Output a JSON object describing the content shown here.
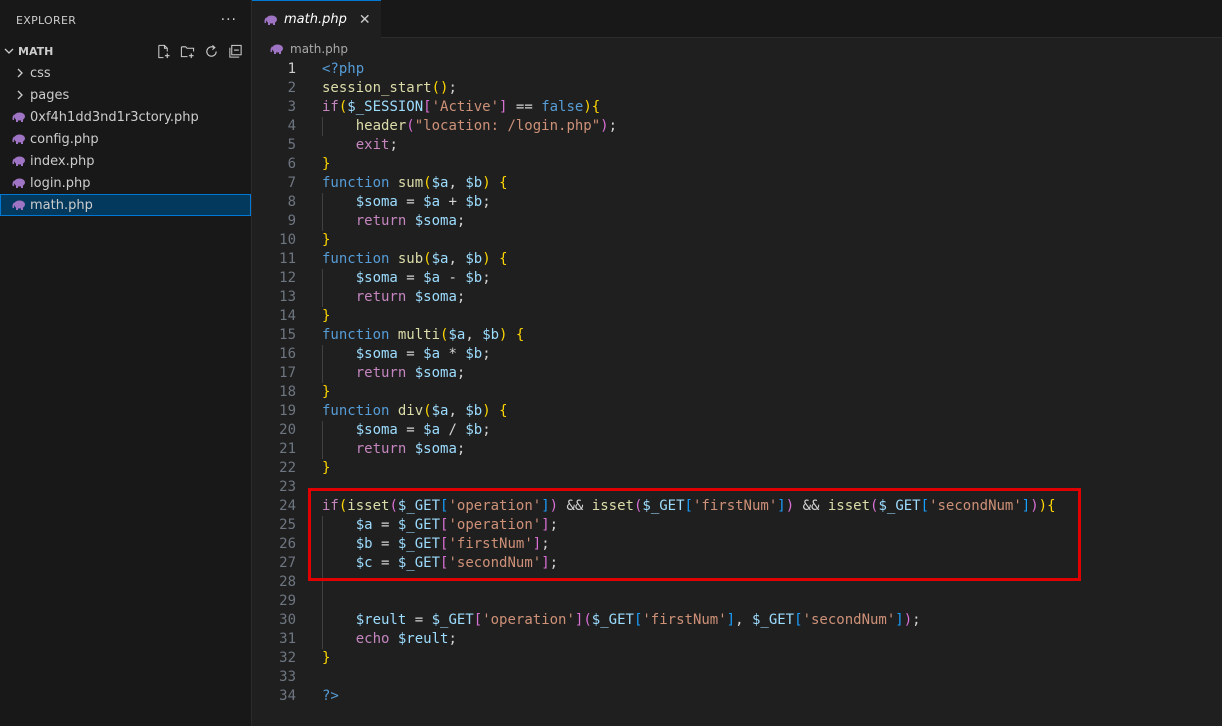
{
  "explorer": {
    "title": "EXPLORER",
    "more": "···",
    "folder": "MATH",
    "items": [
      {
        "type": "dir",
        "label": "css"
      },
      {
        "type": "dir",
        "label": "pages"
      },
      {
        "type": "file",
        "label": "0xf4h1dd3nd1r3ctory.php"
      },
      {
        "type": "file",
        "label": "config.php"
      },
      {
        "type": "file",
        "label": "index.php"
      },
      {
        "type": "file",
        "label": "login.php"
      },
      {
        "type": "file",
        "label": "math.php",
        "selected": true
      }
    ]
  },
  "editor": {
    "tab_label": "math.php",
    "breadcrumb": "math.php",
    "active_line": 1,
    "highlight_color": "#e00000",
    "lines": [
      [
        [
          "b",
          "<?php"
        ]
      ],
      [
        [
          "f",
          "session_start"
        ],
        [
          "p1",
          "()"
        ],
        [
          "t",
          ";"
        ]
      ],
      [
        [
          "k",
          "if"
        ],
        [
          "p1",
          "("
        ],
        [
          "v",
          "$_SESSION"
        ],
        [
          "p2",
          "["
        ],
        [
          "s",
          "'Active'"
        ],
        [
          "p2",
          "]"
        ],
        [
          "t",
          " == "
        ],
        [
          "b",
          "false"
        ],
        [
          "p1",
          ")"
        ],
        [
          "p1",
          "{"
        ]
      ],
      [
        [
          "t",
          "    "
        ],
        [
          "f",
          "header"
        ],
        [
          "p2",
          "("
        ],
        [
          "s",
          "\"location: /login.php\""
        ],
        [
          "p2",
          ")"
        ],
        [
          "t",
          ";"
        ]
      ],
      [
        [
          "t",
          "    "
        ],
        [
          "k",
          "exit"
        ],
        [
          "t",
          ";"
        ]
      ],
      [
        [
          "p1",
          "}"
        ]
      ],
      [
        [
          "b",
          "function"
        ],
        [
          "t",
          " "
        ],
        [
          "f",
          "sum"
        ],
        [
          "p1",
          "("
        ],
        [
          "v",
          "$a"
        ],
        [
          "t",
          ", "
        ],
        [
          "v",
          "$b"
        ],
        [
          "p1",
          ")"
        ],
        [
          "t",
          " "
        ],
        [
          "p1",
          "{"
        ]
      ],
      [
        [
          "t",
          "    "
        ],
        [
          "v",
          "$soma"
        ],
        [
          "t",
          " = "
        ],
        [
          "v",
          "$a"
        ],
        [
          "t",
          " + "
        ],
        [
          "v",
          "$b"
        ],
        [
          "t",
          ";"
        ]
      ],
      [
        [
          "t",
          "    "
        ],
        [
          "k",
          "return"
        ],
        [
          "t",
          " "
        ],
        [
          "v",
          "$soma"
        ],
        [
          "t",
          ";"
        ]
      ],
      [
        [
          "p1",
          "}"
        ]
      ],
      [
        [
          "b",
          "function"
        ],
        [
          "t",
          " "
        ],
        [
          "f",
          "sub"
        ],
        [
          "p1",
          "("
        ],
        [
          "v",
          "$a"
        ],
        [
          "t",
          ", "
        ],
        [
          "v",
          "$b"
        ],
        [
          "p1",
          ")"
        ],
        [
          "t",
          " "
        ],
        [
          "p1",
          "{"
        ]
      ],
      [
        [
          "t",
          "    "
        ],
        [
          "v",
          "$soma"
        ],
        [
          "t",
          " = "
        ],
        [
          "v",
          "$a"
        ],
        [
          "t",
          " - "
        ],
        [
          "v",
          "$b"
        ],
        [
          "t",
          ";"
        ]
      ],
      [
        [
          "t",
          "    "
        ],
        [
          "k",
          "return"
        ],
        [
          "t",
          " "
        ],
        [
          "v",
          "$soma"
        ],
        [
          "t",
          ";"
        ]
      ],
      [
        [
          "p1",
          "}"
        ]
      ],
      [
        [
          "b",
          "function"
        ],
        [
          "t",
          " "
        ],
        [
          "f",
          "multi"
        ],
        [
          "p1",
          "("
        ],
        [
          "v",
          "$a"
        ],
        [
          "t",
          ", "
        ],
        [
          "v",
          "$b"
        ],
        [
          "p1",
          ")"
        ],
        [
          "t",
          " "
        ],
        [
          "p1",
          "{"
        ]
      ],
      [
        [
          "t",
          "    "
        ],
        [
          "v",
          "$soma"
        ],
        [
          "t",
          " = "
        ],
        [
          "v",
          "$a"
        ],
        [
          "t",
          " * "
        ],
        [
          "v",
          "$b"
        ],
        [
          "t",
          ";"
        ]
      ],
      [
        [
          "t",
          "    "
        ],
        [
          "k",
          "return"
        ],
        [
          "t",
          " "
        ],
        [
          "v",
          "$soma"
        ],
        [
          "t",
          ";"
        ]
      ],
      [
        [
          "p1",
          "}"
        ]
      ],
      [
        [
          "b",
          "function"
        ],
        [
          "t",
          " "
        ],
        [
          "f",
          "div"
        ],
        [
          "p1",
          "("
        ],
        [
          "v",
          "$a"
        ],
        [
          "t",
          ", "
        ],
        [
          "v",
          "$b"
        ],
        [
          "p1",
          ")"
        ],
        [
          "t",
          " "
        ],
        [
          "p1",
          "{"
        ]
      ],
      [
        [
          "t",
          "    "
        ],
        [
          "v",
          "$soma"
        ],
        [
          "t",
          " = "
        ],
        [
          "v",
          "$a"
        ],
        [
          "t",
          " / "
        ],
        [
          "v",
          "$b"
        ],
        [
          "t",
          ";"
        ]
      ],
      [
        [
          "t",
          "    "
        ],
        [
          "k",
          "return"
        ],
        [
          "t",
          " "
        ],
        [
          "v",
          "$soma"
        ],
        [
          "t",
          ";"
        ]
      ],
      [
        [
          "p1",
          "}"
        ]
      ],
      [],
      [
        [
          "k",
          "if"
        ],
        [
          "p1",
          "("
        ],
        [
          "f",
          "isset"
        ],
        [
          "p2",
          "("
        ],
        [
          "v",
          "$_GET"
        ],
        [
          "p3",
          "["
        ],
        [
          "s",
          "'operation'"
        ],
        [
          "p3",
          "]"
        ],
        [
          "p2",
          ")"
        ],
        [
          "t",
          " && "
        ],
        [
          "f",
          "isset"
        ],
        [
          "p2",
          "("
        ],
        [
          "v",
          "$_GET"
        ],
        [
          "p3",
          "["
        ],
        [
          "s",
          "'firstNum'"
        ],
        [
          "p3",
          "]"
        ],
        [
          "p2",
          ")"
        ],
        [
          "t",
          " && "
        ],
        [
          "f",
          "isset"
        ],
        [
          "p2",
          "("
        ],
        [
          "v",
          "$_GET"
        ],
        [
          "p3",
          "["
        ],
        [
          "s",
          "'secondNum'"
        ],
        [
          "p3",
          "]"
        ],
        [
          "p2",
          ")"
        ],
        [
          "p1",
          ")"
        ],
        [
          "p1",
          "{"
        ]
      ],
      [
        [
          "t",
          "    "
        ],
        [
          "v",
          "$a"
        ],
        [
          "t",
          " = "
        ],
        [
          "v",
          "$_GET"
        ],
        [
          "p2",
          "["
        ],
        [
          "s",
          "'operation'"
        ],
        [
          "p2",
          "]"
        ],
        [
          "t",
          ";"
        ]
      ],
      [
        [
          "t",
          "    "
        ],
        [
          "v",
          "$b"
        ],
        [
          "t",
          " = "
        ],
        [
          "v",
          "$_GET"
        ],
        [
          "p2",
          "["
        ],
        [
          "s",
          "'firstNum'"
        ],
        [
          "p2",
          "]"
        ],
        [
          "t",
          ";"
        ]
      ],
      [
        [
          "t",
          "    "
        ],
        [
          "v",
          "$c"
        ],
        [
          "t",
          " = "
        ],
        [
          "v",
          "$_GET"
        ],
        [
          "p2",
          "["
        ],
        [
          "s",
          "'secondNum'"
        ],
        [
          "p2",
          "]"
        ],
        [
          "t",
          ";"
        ]
      ],
      [],
      [],
      [
        [
          "t",
          "    "
        ],
        [
          "v",
          "$reult"
        ],
        [
          "t",
          " = "
        ],
        [
          "v",
          "$_GET"
        ],
        [
          "p2",
          "["
        ],
        [
          "s",
          "'operation'"
        ],
        [
          "p2",
          "]"
        ],
        [
          "p2",
          "("
        ],
        [
          "v",
          "$_GET"
        ],
        [
          "p3",
          "["
        ],
        [
          "s",
          "'firstNum'"
        ],
        [
          "p3",
          "]"
        ],
        [
          "t",
          ", "
        ],
        [
          "v",
          "$_GET"
        ],
        [
          "p3",
          "["
        ],
        [
          "s",
          "'secondNum'"
        ],
        [
          "p3",
          "]"
        ],
        [
          "p2",
          ")"
        ],
        [
          "t",
          ";"
        ]
      ],
      [
        [
          "t",
          "    "
        ],
        [
          "k",
          "echo"
        ],
        [
          "t",
          " "
        ],
        [
          "v",
          "$reult"
        ],
        [
          "t",
          ";"
        ]
      ],
      [
        [
          "p1",
          "}"
        ]
      ],
      [],
      [
        [
          "b",
          "?>"
        ]
      ]
    ]
  }
}
